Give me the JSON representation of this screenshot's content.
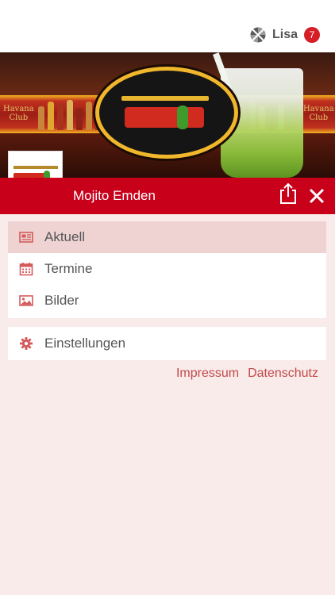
{
  "header": {
    "user_name": "Lisa",
    "notification_count": "7",
    "user_icon": "segmented-circle-icon"
  },
  "banner": {
    "club_text": [
      "Havana",
      "Club"
    ]
  },
  "venue": {
    "name": "Mojito Emden"
  },
  "menu": {
    "items": [
      {
        "label": "Aktuell",
        "icon": "newspaper-icon",
        "active": true
      },
      {
        "label": "Termine",
        "icon": "calendar-icon",
        "active": false
      },
      {
        "label": "Bilder",
        "icon": "image-icon",
        "active": false
      }
    ],
    "settings": {
      "label": "Einstellungen",
      "icon": "gear-icon"
    }
  },
  "footer": {
    "impressum": "Impressum",
    "datenschutz": "Datenschutz"
  },
  "colors": {
    "primary": "#c8001a",
    "badge": "#d51e25",
    "background": "#f8ebea",
    "active_row": "#efd3d3",
    "link": "#c24a4a"
  }
}
